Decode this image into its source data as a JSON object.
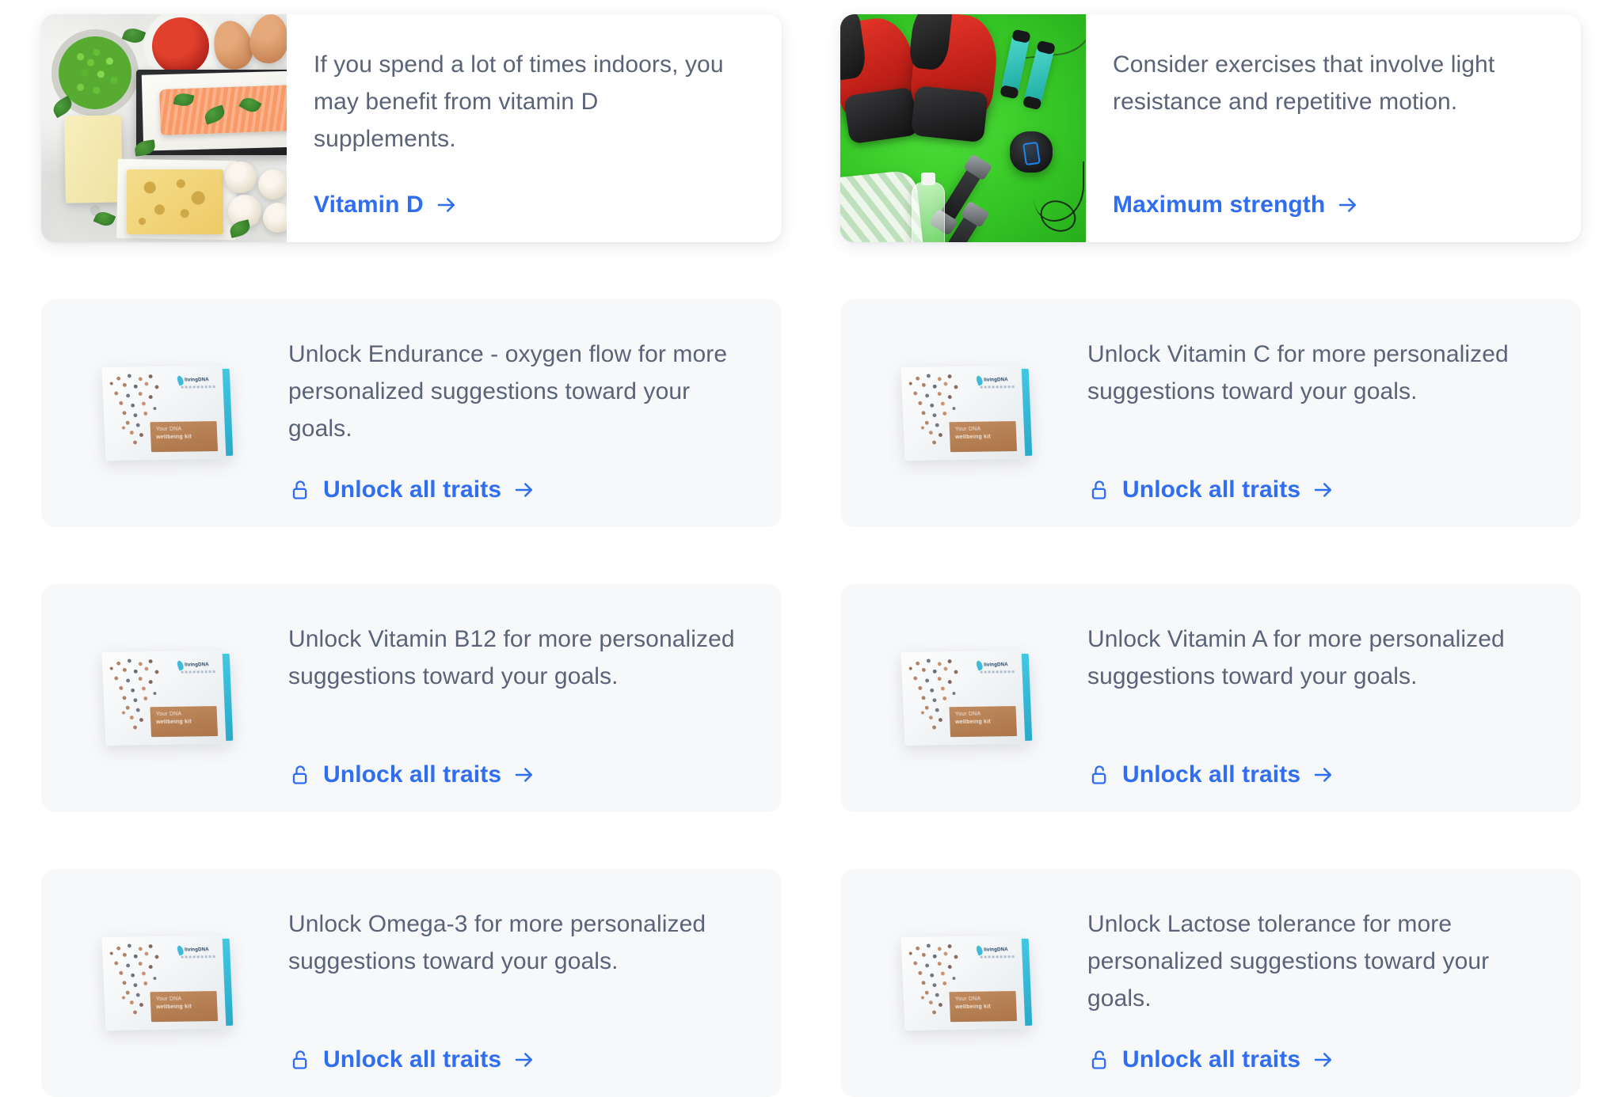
{
  "page": {
    "background": "#ffffff",
    "link_color": "#2f6ef0",
    "text_color": "#5a6378",
    "locked_card_bg": "#f7f8fa",
    "featured_card_bg": "#ffffff"
  },
  "cards": [
    {
      "id": "vitamin-d",
      "type": "featured",
      "image": "vitamin-d-foods-photo",
      "description": "If you spend a lot of times indoors, you may benefit from vitamin D supplements.",
      "cta_label": "Vitamin D",
      "cta_icon": "arrow-right-icon",
      "has_lock": false
    },
    {
      "id": "maximum-strength",
      "type": "featured",
      "image": "fitness-equipment-photo",
      "description": "Consider exercises that involve light resistance and repetitive motion.",
      "cta_label": "Maximum strength",
      "cta_icon": "arrow-right-icon",
      "has_lock": false
    },
    {
      "id": "endurance",
      "type": "locked",
      "image": "dna-wellbeing-kit-box",
      "description": "Unlock Endurance - oxygen flow for more personalized suggestions toward your goals.",
      "cta_label": "Unlock all traits",
      "cta_icon": "arrow-right-icon",
      "lock_icon": "unlocked-padlock-icon",
      "has_lock": true
    },
    {
      "id": "vitamin-c",
      "type": "locked",
      "image": "dna-wellbeing-kit-box",
      "description": "Unlock Vitamin C for more personalized suggestions toward your goals.",
      "cta_label": "Unlock all traits",
      "cta_icon": "arrow-right-icon",
      "lock_icon": "unlocked-padlock-icon",
      "has_lock": true
    },
    {
      "id": "vitamin-b12",
      "type": "locked",
      "image": "dna-wellbeing-kit-box",
      "description": "Unlock Vitamin B12 for more personalized suggestions toward your goals.",
      "cta_label": "Unlock all traits",
      "cta_icon": "arrow-right-icon",
      "lock_icon": "unlocked-padlock-icon",
      "has_lock": true
    },
    {
      "id": "vitamin-a",
      "type": "locked",
      "image": "dna-wellbeing-kit-box",
      "description": "Unlock Vitamin A for more personalized suggestions toward your goals.",
      "cta_label": "Unlock all traits",
      "cta_icon": "arrow-right-icon",
      "lock_icon": "unlocked-padlock-icon",
      "has_lock": true
    },
    {
      "id": "omega-3",
      "type": "locked",
      "image": "dna-wellbeing-kit-box",
      "description": "Unlock Omega-3 for more personalized suggestions toward your goals.",
      "cta_label": "Unlock all traits",
      "cta_icon": "arrow-right-icon",
      "lock_icon": "unlocked-padlock-icon",
      "has_lock": true
    },
    {
      "id": "lactose-tolerance",
      "type": "locked",
      "image": "dna-wellbeing-kit-box",
      "description": "Unlock Lactose tolerance for more personalized suggestions toward your goals.",
      "cta_label": "Unlock all traits",
      "cta_icon": "arrow-right-icon",
      "lock_icon": "unlocked-padlock-icon",
      "has_lock": true
    }
  ],
  "kit_box": {
    "brand": "livingDNA",
    "band_line1": "Your DNA",
    "band_line2": "wellbeing kit"
  }
}
